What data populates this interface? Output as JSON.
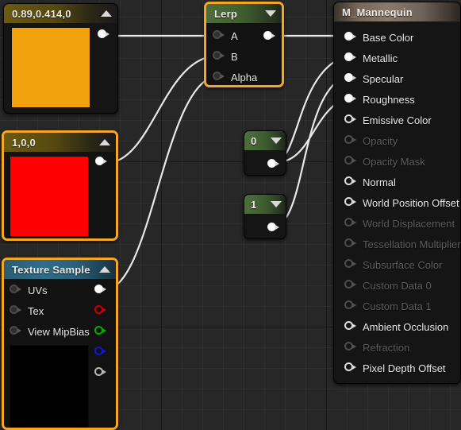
{
  "editor": {
    "name": "unreal-material-graph",
    "canvas_bg": "#272727",
    "wire_color": "#e8e8e8",
    "selection_color": "#f5a623"
  },
  "nodes": {
    "constant3_orange": {
      "title": "0.89,0.414,0",
      "collapse_icon": "caret-up-icon",
      "swatch_color": "#f2a20c",
      "selected": false,
      "output_pin": "output-pin"
    },
    "constant3_red": {
      "title": "1,0,0",
      "collapse_icon": "caret-up-icon",
      "swatch_color": "#ff0000",
      "selected": true,
      "output_pin": "output-pin"
    },
    "texture_sample": {
      "title": "Texture Sample",
      "collapse_icon": "caret-up-icon",
      "selected": true,
      "inputs": [
        {
          "label": "UVs",
          "state": "disabled"
        },
        {
          "label": "Tex",
          "state": "disabled"
        },
        {
          "label": "View MipBias",
          "state": "disabled"
        }
      ],
      "outputs": [
        {
          "name": "rgb-output-pin",
          "color": "#ffffff",
          "style": "filled"
        },
        {
          "name": "r-output-pin",
          "color": "#cc0000",
          "style": "hollow"
        },
        {
          "name": "g-output-pin",
          "color": "#00b000",
          "style": "hollow"
        },
        {
          "name": "b-output-pin",
          "color": "#1515cc",
          "style": "hollow"
        },
        {
          "name": "a-output-pin",
          "color": "#b8b8b8",
          "style": "hollow"
        }
      ],
      "preview_color": "#000000"
    },
    "lerp": {
      "title": "Lerp",
      "collapse_icon": "caret-down-icon",
      "selected": true,
      "inputs": [
        {
          "label": "A"
        },
        {
          "label": "B"
        },
        {
          "label": "Alpha"
        }
      ],
      "output_pin": "output-pin"
    },
    "constant_zero": {
      "title": "0",
      "collapse_icon": "caret-down-icon",
      "selected": false,
      "output_pin": "output-pin"
    },
    "constant_one": {
      "title": "1",
      "collapse_icon": "caret-down-icon",
      "selected": false,
      "output_pin": "output-pin"
    },
    "material_output": {
      "title": "M_Mannequin",
      "inputs": [
        {
          "label": "Base Color",
          "state": "connected"
        },
        {
          "label": "Metallic",
          "state": "connected"
        },
        {
          "label": "Specular",
          "state": "connected"
        },
        {
          "label": "Roughness",
          "state": "connected"
        },
        {
          "label": "Emissive Color",
          "state": "enabled"
        },
        {
          "label": "Opacity",
          "state": "disabled"
        },
        {
          "label": "Opacity Mask",
          "state": "disabled"
        },
        {
          "label": "Normal",
          "state": "enabled"
        },
        {
          "label": "World Position Offset",
          "state": "enabled"
        },
        {
          "label": "World Displacement",
          "state": "disabled"
        },
        {
          "label": "Tessellation Multiplier",
          "state": "disabled"
        },
        {
          "label": "Subsurface Color",
          "state": "disabled"
        },
        {
          "label": "Custom Data 0",
          "state": "disabled"
        },
        {
          "label": "Custom Data 1",
          "state": "disabled"
        },
        {
          "label": "Ambient Occlusion",
          "state": "enabled"
        },
        {
          "label": "Refraction",
          "state": "disabled"
        },
        {
          "label": "Pixel Depth Offset",
          "state": "enabled"
        }
      ]
    }
  }
}
